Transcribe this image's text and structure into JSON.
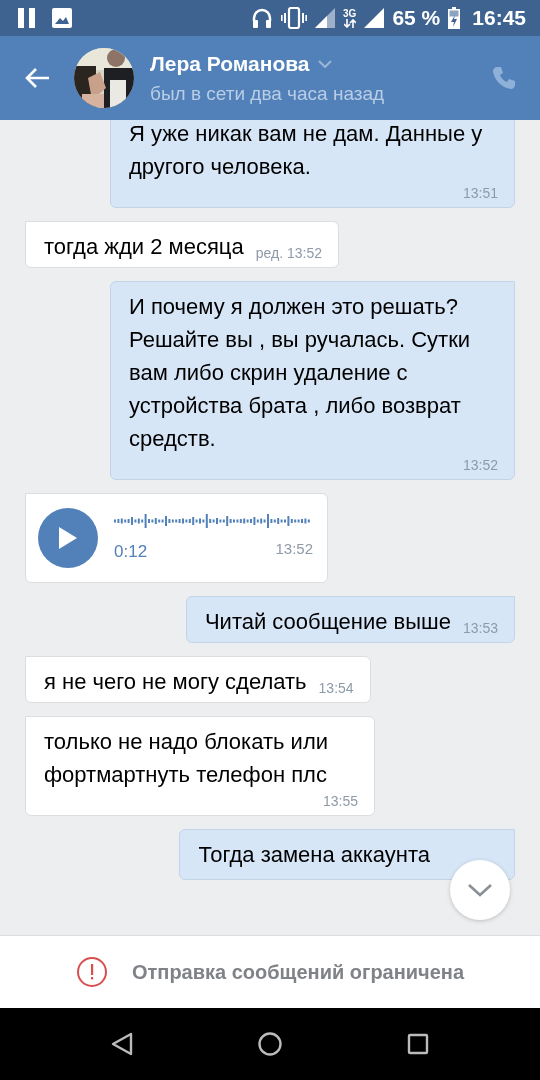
{
  "status_bar": {
    "network": "3G",
    "battery": "65 %",
    "time": "16:45"
  },
  "header": {
    "name": "Лера Романова",
    "status": "был в сети два часа назад"
  },
  "messages": [
    {
      "kind": "text",
      "outgoing": true,
      "text": "Я уже никак вам не дам. Данные у другого человека.",
      "time": "13:51"
    },
    {
      "kind": "text",
      "outgoing": false,
      "text": "тогда жди 2 месяца",
      "time": "ред. 13:52"
    },
    {
      "kind": "text",
      "outgoing": true,
      "text": "И почему я должен это решать? Решайте вы , вы ручалась. Сутки вам либо скрин удаление с устройства брата , либо возврат средств.",
      "time": "13:52"
    },
    {
      "kind": "voice",
      "outgoing": false,
      "duration": "0:12",
      "time": "13:52"
    },
    {
      "kind": "text",
      "outgoing": true,
      "text": "Читай сообщение выше",
      "time": "13:53"
    },
    {
      "kind": "text",
      "outgoing": false,
      "text": "я не чего не могу сделать",
      "time": "13:54"
    },
    {
      "kind": "text",
      "outgoing": false,
      "text": "только не надо блокать или фортмартнуть телефон плс",
      "time": "13:55"
    },
    {
      "kind": "text",
      "outgoing": true,
      "text": "Тогда замена аккаунта"
    }
  ],
  "composer": {
    "notice": "Отправка сообщений ограничена"
  }
}
